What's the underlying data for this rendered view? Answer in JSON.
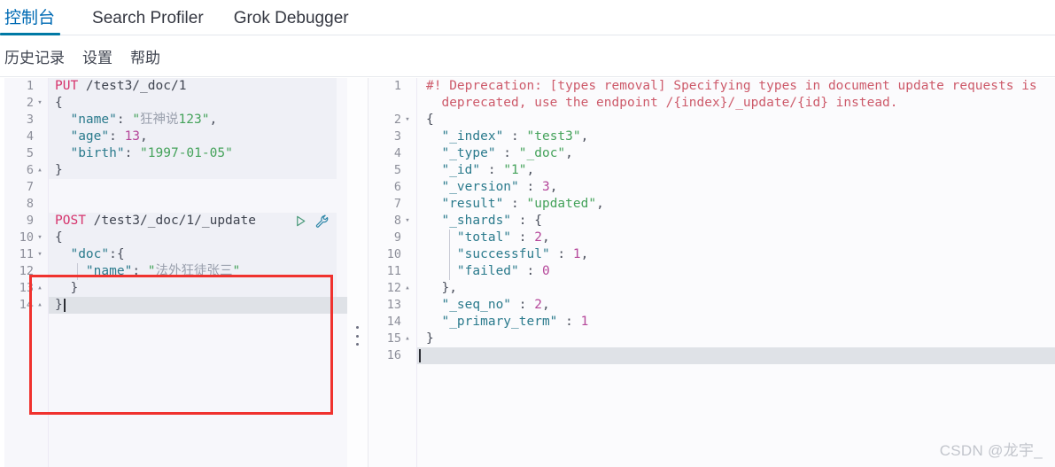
{
  "tabs": [
    {
      "label": "控制台",
      "active": true,
      "name": "tab-console"
    },
    {
      "label": "Search Profiler",
      "active": false,
      "name": "tab-search-profiler"
    },
    {
      "label": "Grok Debugger",
      "active": false,
      "name": "tab-grok-debugger"
    }
  ],
  "subnav": [
    {
      "label": "历史记录",
      "name": "subnav-history"
    },
    {
      "label": "设置",
      "name": "subnav-settings"
    },
    {
      "label": "帮助",
      "name": "subnav-help"
    }
  ],
  "editor": {
    "active_line": 14,
    "lines": [
      {
        "n": "1",
        "fold": "",
        "tokens": [
          {
            "t": "PUT",
            "c": "k-method"
          },
          {
            "t": " /test3/_doc/1",
            "c": "k-url"
          }
        ]
      },
      {
        "n": "2",
        "fold": "▾",
        "tokens": [
          {
            "t": "{",
            "c": "k-punct"
          }
        ]
      },
      {
        "n": "3",
        "fold": "",
        "tokens": [
          {
            "t": "  \"name\"",
            "c": "k-key"
          },
          {
            "t": ": ",
            "c": "k-colon"
          },
          {
            "t": "\"",
            "c": "k-str"
          },
          {
            "t": "狂神说",
            "c": "k-cjk"
          },
          {
            "t": "123\"",
            "c": "k-str"
          },
          {
            "t": ",",
            "c": "k-punct"
          }
        ]
      },
      {
        "n": "4",
        "fold": "",
        "tokens": [
          {
            "t": "  \"age\"",
            "c": "k-key"
          },
          {
            "t": ": ",
            "c": "k-colon"
          },
          {
            "t": "13",
            "c": "k-num"
          },
          {
            "t": ",",
            "c": "k-punct"
          }
        ]
      },
      {
        "n": "5",
        "fold": "",
        "tokens": [
          {
            "t": "  \"birth\"",
            "c": "k-key"
          },
          {
            "t": ": ",
            "c": "k-colon"
          },
          {
            "t": "\"1997-01-05\"",
            "c": "k-str"
          }
        ]
      },
      {
        "n": "6",
        "fold": "▴",
        "tokens": [
          {
            "t": "}",
            "c": "k-punct"
          }
        ]
      },
      {
        "n": "7",
        "fold": "",
        "tokens": []
      },
      {
        "n": "8",
        "fold": "",
        "tokens": []
      },
      {
        "n": "9",
        "fold": "",
        "tokens": [
          {
            "t": "POST",
            "c": "k-method"
          },
          {
            "t": " /test3/_doc/1/_update",
            "c": "k-url"
          }
        ]
      },
      {
        "n": "10",
        "fold": "▾",
        "tokens": [
          {
            "t": "{",
            "c": "k-punct"
          }
        ]
      },
      {
        "n": "11",
        "fold": "▾",
        "tokens": [
          {
            "t": "  \"doc\"",
            "c": "k-key"
          },
          {
            "t": ":{",
            "c": "k-punct"
          }
        ]
      },
      {
        "n": "12",
        "fold": "",
        "tokens": [
          {
            "t": "    \"name\"",
            "c": "k-key"
          },
          {
            "t": ": ",
            "c": "k-colon"
          },
          {
            "t": "\"",
            "c": "k-str"
          },
          {
            "t": "法外狂徒张三",
            "c": "k-cjk"
          },
          {
            "t": "\"",
            "c": "k-str"
          }
        ]
      },
      {
        "n": "13",
        "fold": "▴",
        "tokens": [
          {
            "t": "  }",
            "c": "k-punct"
          }
        ]
      },
      {
        "n": "14",
        "fold": "▴",
        "tokens": [
          {
            "t": "}",
            "c": "k-punct"
          }
        ]
      }
    ],
    "actions": {
      "play": {
        "name": "send-request-play-icon",
        "title": "▷"
      },
      "wrench": {
        "name": "wrench-icon",
        "title": "wrench"
      }
    }
  },
  "output": {
    "active_line": 16,
    "deprecation": "#! Deprecation: [types removal] Specifying types in document update requests is deprecated, use the endpoint /{index}/_update/{id} instead.",
    "lines": [
      {
        "n": "1",
        "fold": "",
        "tall": true,
        "tokens": [
          {
            "t": "#! Deprecation: [types removal] Specifying types in document update requests is",
            "c": "k-depr"
          },
          {
            "t": "\n  deprecated, use the endpoint /{index}/_update/{id} instead.",
            "c": "k-depr"
          }
        ]
      },
      {
        "n": "2",
        "fold": "▾",
        "tokens": [
          {
            "t": "{",
            "c": "k-punct"
          }
        ]
      },
      {
        "n": "3",
        "fold": "",
        "tokens": [
          {
            "t": "  \"_index\"",
            "c": "k-key"
          },
          {
            "t": " : ",
            "c": "k-colon"
          },
          {
            "t": "\"test3\"",
            "c": "k-str"
          },
          {
            "t": ",",
            "c": "k-punct"
          }
        ]
      },
      {
        "n": "4",
        "fold": "",
        "tokens": [
          {
            "t": "  \"_type\"",
            "c": "k-key"
          },
          {
            "t": " : ",
            "c": "k-colon"
          },
          {
            "t": "\"_doc\"",
            "c": "k-str"
          },
          {
            "t": ",",
            "c": "k-punct"
          }
        ]
      },
      {
        "n": "5",
        "fold": "",
        "tokens": [
          {
            "t": "  \"_id\"",
            "c": "k-key"
          },
          {
            "t": " : ",
            "c": "k-colon"
          },
          {
            "t": "\"1\"",
            "c": "k-str"
          },
          {
            "t": ",",
            "c": "k-punct"
          }
        ]
      },
      {
        "n": "6",
        "fold": "",
        "tokens": [
          {
            "t": "  \"_version\"",
            "c": "k-key"
          },
          {
            "t": " : ",
            "c": "k-colon"
          },
          {
            "t": "3",
            "c": "k-num"
          },
          {
            "t": ",",
            "c": "k-punct"
          }
        ]
      },
      {
        "n": "7",
        "fold": "",
        "tokens": [
          {
            "t": "  \"result\"",
            "c": "k-key"
          },
          {
            "t": " : ",
            "c": "k-colon"
          },
          {
            "t": "\"updated\"",
            "c": "k-str"
          },
          {
            "t": ",",
            "c": "k-punct"
          }
        ]
      },
      {
        "n": "8",
        "fold": "▾",
        "tokens": [
          {
            "t": "  \"_shards\"",
            "c": "k-key"
          },
          {
            "t": " : ",
            "c": "k-colon"
          },
          {
            "t": "{",
            "c": "k-punct"
          }
        ]
      },
      {
        "n": "9",
        "fold": "",
        "tokens": [
          {
            "t": "    \"total\"",
            "c": "k-key"
          },
          {
            "t": " : ",
            "c": "k-colon"
          },
          {
            "t": "2",
            "c": "k-num"
          },
          {
            "t": ",",
            "c": "k-punct"
          }
        ]
      },
      {
        "n": "10",
        "fold": "",
        "tokens": [
          {
            "t": "    \"successful\"",
            "c": "k-key"
          },
          {
            "t": " : ",
            "c": "k-colon"
          },
          {
            "t": "1",
            "c": "k-num"
          },
          {
            "t": ",",
            "c": "k-punct"
          }
        ]
      },
      {
        "n": "11",
        "fold": "",
        "tokens": [
          {
            "t": "    \"failed\"",
            "c": "k-key"
          },
          {
            "t": " : ",
            "c": "k-colon"
          },
          {
            "t": "0",
            "c": "k-num"
          }
        ]
      },
      {
        "n": "12",
        "fold": "▴",
        "tokens": [
          {
            "t": "  },",
            "c": "k-punct"
          }
        ]
      },
      {
        "n": "13",
        "fold": "",
        "tokens": [
          {
            "t": "  \"_seq_no\"",
            "c": "k-key"
          },
          {
            "t": " : ",
            "c": "k-colon"
          },
          {
            "t": "2",
            "c": "k-num"
          },
          {
            "t": ",",
            "c": "k-punct"
          }
        ]
      },
      {
        "n": "14",
        "fold": "",
        "tokens": [
          {
            "t": "  \"_primary_term\"",
            "c": "k-key"
          },
          {
            "t": " : ",
            "c": "k-colon"
          },
          {
            "t": "1",
            "c": "k-num"
          }
        ]
      },
      {
        "n": "15",
        "fold": "▴",
        "tokens": [
          {
            "t": "}",
            "c": "k-punct"
          }
        ]
      },
      {
        "n": "16",
        "fold": "",
        "tokens": []
      }
    ]
  },
  "annotation": {
    "color": "#f0322e",
    "label": "red-highlight-box"
  },
  "watermark": {
    "text": "CSDN @龙宇_"
  },
  "colors": {
    "accent": "#0079a5",
    "method": "#d6336c",
    "string": "#44a25a",
    "key": "#2a7a8c",
    "number": "#b5479a",
    "deprecation": "#cd5a6a",
    "annotation": "#f0322e"
  }
}
